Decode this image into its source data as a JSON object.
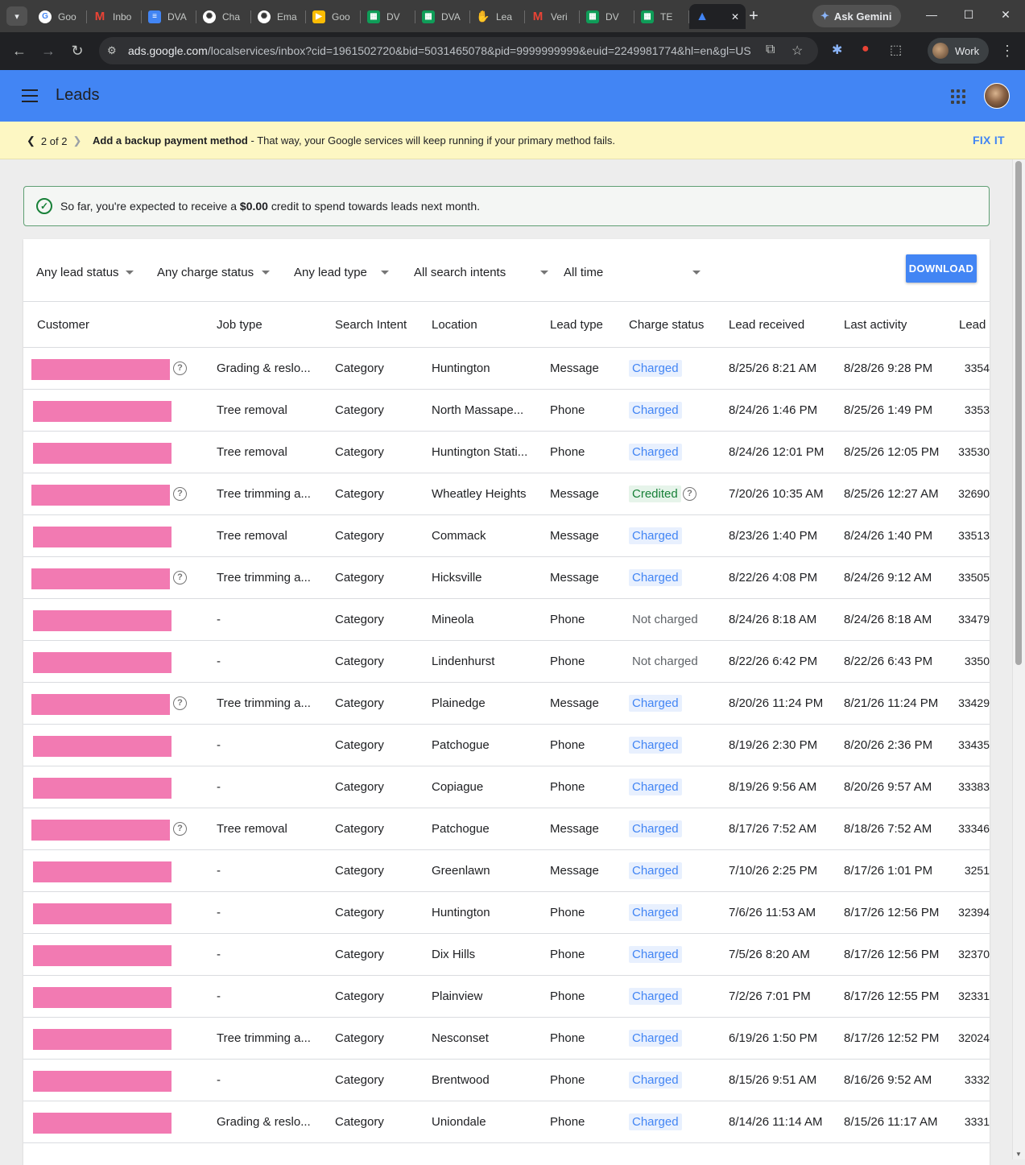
{
  "browser": {
    "tabs": [
      {
        "icon": "google-icon",
        "title": "Goo",
        "active": false
      },
      {
        "icon": "gmail-icon",
        "title": "Inbo",
        "active": false
      },
      {
        "icon": "docs-icon",
        "title": "DVA",
        "active": false
      },
      {
        "icon": "chatgpt-icon",
        "title": "Cha",
        "active": false
      },
      {
        "icon": "chatgpt-icon",
        "title": "Ema",
        "active": false
      },
      {
        "icon": "meet-icon",
        "title": "Goo",
        "active": false
      },
      {
        "icon": "sheets-icon",
        "title": "DV",
        "active": false
      },
      {
        "icon": "sheets-icon",
        "title": "DVA",
        "active": false
      },
      {
        "icon": "hand-icon",
        "title": "Lea",
        "active": false
      },
      {
        "icon": "gmail-icon",
        "title": "Veri",
        "active": false
      },
      {
        "icon": "sheets-icon",
        "title": "DV",
        "active": false
      },
      {
        "icon": "sheets-icon",
        "title": "TE",
        "active": false
      },
      {
        "icon": "google-ads-icon",
        "title": "",
        "active": true
      }
    ],
    "ask_gemini": "Ask Gemini",
    "url_host": "ads.google.com",
    "url_path": "/localservices/inbox?cid=1961502720&bid=5031465078&pid=9999999999&euid=2249981774&hl=en&gl=US",
    "profile_label": "Work"
  },
  "app": {
    "title": "Leads"
  },
  "notice": {
    "pager": "2 of 2",
    "bold": "Add a backup payment method",
    "text": " - That way, your Google services will keep running if your primary method fails.",
    "action": "FIX IT"
  },
  "credit": {
    "prefix": "So far, you're expected to receive a ",
    "amount": "$0.00",
    "suffix": " credit to spend towards leads next month."
  },
  "filters": {
    "lead_status": "Any lead status",
    "charge_status": "Any charge status",
    "lead_type": "Any lead type",
    "search_intent": "All search intents",
    "time": "All time",
    "download": "DOWNLOAD"
  },
  "table": {
    "headers": [
      "Customer",
      "Job type",
      "Search Intent",
      "Location",
      "Lead type",
      "Charge status",
      "Lead received",
      "Last activity",
      "Lead"
    ],
    "rows": [
      {
        "help": true,
        "job": "Grading & reslo...",
        "intent": "Category",
        "location": "Huntington",
        "lead_type": "Message",
        "charge": "Charged",
        "kind": "charged",
        "received": "8/25/26 8:21 AM",
        "activity": "8/28/26 9:28 PM",
        "lead_id": "3354"
      },
      {
        "help": false,
        "job": "Tree removal",
        "intent": "Category",
        "location": "North Massape...",
        "lead_type": "Phone",
        "charge": "Charged",
        "kind": "charged",
        "received": "8/24/26 1:46 PM",
        "activity": "8/25/26 1:49 PM",
        "lead_id": "3353"
      },
      {
        "help": false,
        "job": "Tree removal",
        "intent": "Category",
        "location": "Huntington Stati...",
        "lead_type": "Phone",
        "charge": "Charged",
        "kind": "charged",
        "received": "8/24/26 12:01 PM",
        "activity": "8/25/26 12:05 PM",
        "lead_id": "33530"
      },
      {
        "help": true,
        "job": "Tree trimming a...",
        "intent": "Category",
        "location": "Wheatley Heights",
        "lead_type": "Message",
        "charge": "Credited",
        "kind": "credited",
        "received": "7/20/26 10:35 AM",
        "activity": "8/25/26 12:27 AM",
        "lead_id": "32690"
      },
      {
        "help": false,
        "job": "Tree removal",
        "intent": "Category",
        "location": "Commack",
        "lead_type": "Message",
        "charge": "Charged",
        "kind": "charged",
        "received": "8/23/26 1:40 PM",
        "activity": "8/24/26 1:40 PM",
        "lead_id": "33513"
      },
      {
        "help": true,
        "job": "Tree trimming a...",
        "intent": "Category",
        "location": "Hicksville",
        "lead_type": "Message",
        "charge": "Charged",
        "kind": "charged",
        "received": "8/22/26 4:08 PM",
        "activity": "8/24/26 9:12 AM",
        "lead_id": "33505"
      },
      {
        "help": false,
        "job": "-",
        "intent": "Category",
        "location": "Mineola",
        "lead_type": "Phone",
        "charge": "Not charged",
        "kind": "not",
        "received": "8/24/26 8:18 AM",
        "activity": "8/24/26 8:18 AM",
        "lead_id": "33479"
      },
      {
        "help": false,
        "job": "-",
        "intent": "Category",
        "location": "Lindenhurst",
        "lead_type": "Phone",
        "charge": "Not charged",
        "kind": "not",
        "received": "8/22/26 6:42 PM",
        "activity": "8/22/26 6:43 PM",
        "lead_id": "3350"
      },
      {
        "help": true,
        "job": "Tree trimming a...",
        "intent": "Category",
        "location": "Plainedge",
        "lead_type": "Message",
        "charge": "Charged",
        "kind": "charged",
        "received": "8/20/26 11:24 PM",
        "activity": "8/21/26 11:24 PM",
        "lead_id": "33429"
      },
      {
        "help": false,
        "job": "-",
        "intent": "Category",
        "location": "Patchogue",
        "lead_type": "Phone",
        "charge": "Charged",
        "kind": "charged",
        "received": "8/19/26 2:30 PM",
        "activity": "8/20/26 2:36 PM",
        "lead_id": "33435"
      },
      {
        "help": false,
        "job": "-",
        "intent": "Category",
        "location": "Copiague",
        "lead_type": "Phone",
        "charge": "Charged",
        "kind": "charged",
        "received": "8/19/26 9:56 AM",
        "activity": "8/20/26 9:57 AM",
        "lead_id": "33383"
      },
      {
        "help": true,
        "job": "Tree removal",
        "intent": "Category",
        "location": "Patchogue",
        "lead_type": "Message",
        "charge": "Charged",
        "kind": "charged",
        "received": "8/17/26 7:52 AM",
        "activity": "8/18/26 7:52 AM",
        "lead_id": "33346"
      },
      {
        "help": false,
        "job": "-",
        "intent": "Category",
        "location": "Greenlawn",
        "lead_type": "Message",
        "charge": "Charged",
        "kind": "charged",
        "received": "7/10/26 2:25 PM",
        "activity": "8/17/26 1:01 PM",
        "lead_id": "3251"
      },
      {
        "help": false,
        "job": "-",
        "intent": "Category",
        "location": "Huntington",
        "lead_type": "Phone",
        "charge": "Charged",
        "kind": "charged",
        "received": "7/6/26 11:53 AM",
        "activity": "8/17/26 12:56 PM",
        "lead_id": "32394"
      },
      {
        "help": false,
        "job": "-",
        "intent": "Category",
        "location": "Dix Hills",
        "lead_type": "Phone",
        "charge": "Charged",
        "kind": "charged",
        "received": "7/5/26 8:20 AM",
        "activity": "8/17/26 12:56 PM",
        "lead_id": "32370"
      },
      {
        "help": false,
        "job": "-",
        "intent": "Category",
        "location": "Plainview",
        "lead_type": "Phone",
        "charge": "Charged",
        "kind": "charged",
        "received": "7/2/26 7:01 PM",
        "activity": "8/17/26 12:55 PM",
        "lead_id": "32331"
      },
      {
        "help": false,
        "job": "Tree trimming a...",
        "intent": "Category",
        "location": "Nesconset",
        "lead_type": "Phone",
        "charge": "Charged",
        "kind": "charged",
        "received": "6/19/26 1:50 PM",
        "activity": "8/17/26 12:52 PM",
        "lead_id": "32024"
      },
      {
        "help": false,
        "job": "-",
        "intent": "Category",
        "location": "Brentwood",
        "lead_type": "Phone",
        "charge": "Charged",
        "kind": "charged",
        "received": "8/15/26 9:51 AM",
        "activity": "8/16/26 9:52 AM",
        "lead_id": "3332"
      },
      {
        "help": false,
        "job": "Grading & reslo...",
        "intent": "Category",
        "location": "Uniondale",
        "lead_type": "Phone",
        "charge": "Charged",
        "kind": "charged",
        "received": "8/14/26 11:14 AM",
        "activity": "8/15/26 11:17 AM",
        "lead_id": "3331"
      },
      {
        "help": false,
        "job": "",
        "intent": "",
        "location": "",
        "lead_type": "",
        "charge": "",
        "kind": "charged",
        "received": "",
        "activity": "",
        "lead_id": ""
      }
    ]
  }
}
